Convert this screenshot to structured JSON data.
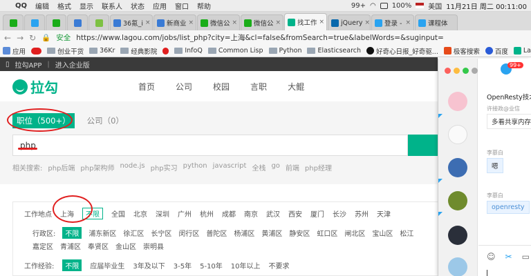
{
  "menubar": {
    "app": "QQ",
    "items": [
      "编辑",
      "格式",
      "显示",
      "联系人",
      "状态",
      "应用",
      "窗口",
      "帮助"
    ],
    "battery": "100%",
    "input_method": "美国",
    "clock": "11月21日 周二  00:11:00",
    "badge": "99+"
  },
  "tabs": [
    {
      "label": "",
      "color": "#1aad19"
    },
    {
      "label": "",
      "color": "#2aa3f0"
    },
    {
      "label": "",
      "color": "#1aad19"
    },
    {
      "label": "",
      "color": "#3a7bd5"
    },
    {
      "label": "",
      "color": "#7dc143"
    },
    {
      "label": "36氪_i",
      "color": "#3a7bd5",
      "icon": "Kr"
    },
    {
      "label": "新商业",
      "color": "#3a7bd5",
      "icon": "Kr"
    },
    {
      "label": "微信公",
      "color": "#1aad19"
    },
    {
      "label": "微信公",
      "color": "#1aad19"
    },
    {
      "label": "找工作",
      "color": "#00b38a",
      "icon": "L",
      "active": true
    },
    {
      "label": "jQuery",
      "color": "#0868ac"
    },
    {
      "label": "登录 -",
      "color": "#2aa3f0"
    },
    {
      "label": "课程体",
      "color": "#2aa3f0"
    }
  ],
  "address": {
    "secure_label": "安全",
    "url": "https://www.lagou.com/jobs/list_php?city=上海&cl=false&fromSearch=true&labelWords=&suginput="
  },
  "bookmarks": [
    "应用",
    "创业干货",
    "36Kr",
    "经典影院",
    "InfoQ",
    "Common Lisp",
    "Python",
    "Elasticsearch",
    "好奇心日报_好奇驱...",
    "极客搜索",
    "百度",
    "La"
  ],
  "topstrip": {
    "app": "拉勾APP",
    "enterprise": "进入企业版"
  },
  "header": {
    "logo_text": "拉勾",
    "nav": [
      "首页",
      "公司",
      "校园",
      "言职",
      "大鲲"
    ]
  },
  "search": {
    "tab_jobs": "职位（500+）",
    "tab_companies": "公司（0）",
    "query": "php",
    "related_label": "相关搜索:",
    "related": [
      "php后端",
      "php架构师",
      "node.js",
      "php实习",
      "python",
      "javascript",
      "全栈",
      "go",
      "前端",
      "php经理"
    ]
  },
  "filters": {
    "location_label": "工作地点",
    "location_selected": "上海",
    "location_any": "不限",
    "cities": [
      "全国",
      "北京",
      "深圳",
      "广州",
      "杭州",
      "成都",
      "南京",
      "武汉",
      "西安",
      "厦门",
      "长沙",
      "苏州",
      "天津"
    ],
    "district_label": "行政区:",
    "district_selected": "不限",
    "districts_row1": [
      "浦东新区",
      "徐汇区",
      "长宁区",
      "闵行区",
      "普陀区",
      "杨浦区",
      "黄浦区",
      "静安区",
      "虹口区",
      "闸北区",
      "宝山区",
      "松江"
    ],
    "districts_row2": [
      "嘉定区",
      "青浦区",
      "奉贤区",
      "金山区",
      "崇明县"
    ],
    "exp_label": "工作经验:",
    "exp_selected": "不限",
    "exp_options": [
      "应届毕业生",
      "3年及以下",
      "3-5年",
      "5-10年",
      "10年以上",
      "不要求"
    ]
  },
  "chat": {
    "badge": "99+",
    "title": "OpenResty技术",
    "messages": [
      {
        "name": "许接政@业信",
        "text": "多看共享内存",
        "blue": false
      },
      {
        "name": "李慕白",
        "text": "嗯",
        "blue": true
      },
      {
        "name": "李慕白",
        "text": "openresty",
        "blue": true
      }
    ]
  }
}
